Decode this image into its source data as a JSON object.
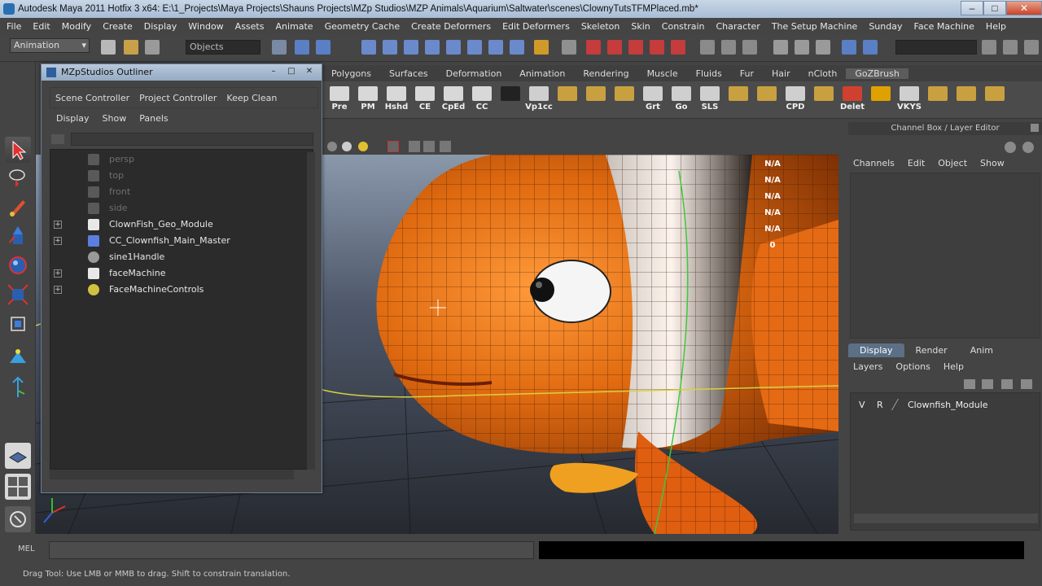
{
  "window": {
    "title": "Autodesk Maya 2011 Hotfix 3 x64: E:\\1_Projects\\Maya Projects\\Shauns Projects\\MZp Studios\\MZP Animals\\Aquarium\\Saltwater\\scenes\\ClownyTutsTFMPlaced.mb*",
    "minimize": "–",
    "maximize": "□",
    "close": "✕"
  },
  "menubar": [
    "File",
    "Edit",
    "Modify",
    "Create",
    "Display",
    "Window",
    "Assets",
    "Animate",
    "Geometry Cache",
    "Create Deformers",
    "Edit Deformers",
    "Skeleton",
    "Skin",
    "Constrain",
    "Character",
    "The Setup Machine",
    "Sunday",
    "Face Machine",
    "Help"
  ],
  "statusline": {
    "mode": "Animation",
    "selection_field": "Objects"
  },
  "shelf_tabs": [
    "Polygons",
    "Surfaces",
    "Deformation",
    "Animation",
    "Rendering",
    "Muscle",
    "Fluids",
    "Fur",
    "Hair",
    "nCloth",
    "GoZBrush"
  ],
  "shelf_buttons": [
    "Pre",
    "PM",
    "Hshd",
    "CE",
    "CpEd",
    "CC",
    "",
    "Vp1cc",
    "",
    "",
    "",
    "Grt",
    "Go",
    "SLS",
    "",
    "",
    "CPD",
    "",
    "Delet",
    "",
    "VKYS",
    "",
    "",
    ""
  ],
  "outliner": {
    "title": "MZpStudios Outliner",
    "toolbar": [
      "Scene Controller",
      "Project Controller",
      "Keep Clean"
    ],
    "menu": [
      "Display",
      "Show",
      "Panels"
    ],
    "items": [
      {
        "label": "persp",
        "dim": true,
        "expand": ""
      },
      {
        "label": "top",
        "dim": true,
        "expand": ""
      },
      {
        "label": "front",
        "dim": true,
        "expand": ""
      },
      {
        "label": "side",
        "dim": true,
        "expand": ""
      },
      {
        "label": "ClownFish_Geo_Module",
        "dim": false,
        "expand": "+"
      },
      {
        "label": "CC_Clownfish_Main_Master",
        "dim": false,
        "expand": "+"
      },
      {
        "label": "sine1Handle",
        "dim": false,
        "expand": ""
      },
      {
        "label": "faceMachine",
        "dim": false,
        "expand": "+"
      },
      {
        "label": "FaceMachineControls",
        "dim": false,
        "expand": "+"
      }
    ]
  },
  "channel_box": {
    "header": "Channel Box / Layer Editor",
    "tabs": [
      "Channels",
      "Edit",
      "Object",
      "Show"
    ]
  },
  "hud_values": [
    "N/A",
    "N/A",
    "N/A",
    "N/A",
    "N/A",
    "0"
  ],
  "layer_editor": {
    "tabs": [
      "Display",
      "Render",
      "Anim"
    ],
    "menu": [
      "Layers",
      "Options",
      "Help"
    ],
    "layer": {
      "v": "V",
      "r": "R",
      "name": "Clownfish_Module"
    }
  },
  "command_line": {
    "label": "MEL"
  },
  "help_line": "Drag Tool: Use LMB or MMB to drag. Shift to constrain translation.",
  "colors": {
    "maya_gray": "#444444",
    "title_blue": "#a7bdd6",
    "fish_orange": "#e07010",
    "layer_tab_active": "#5b6f86"
  }
}
